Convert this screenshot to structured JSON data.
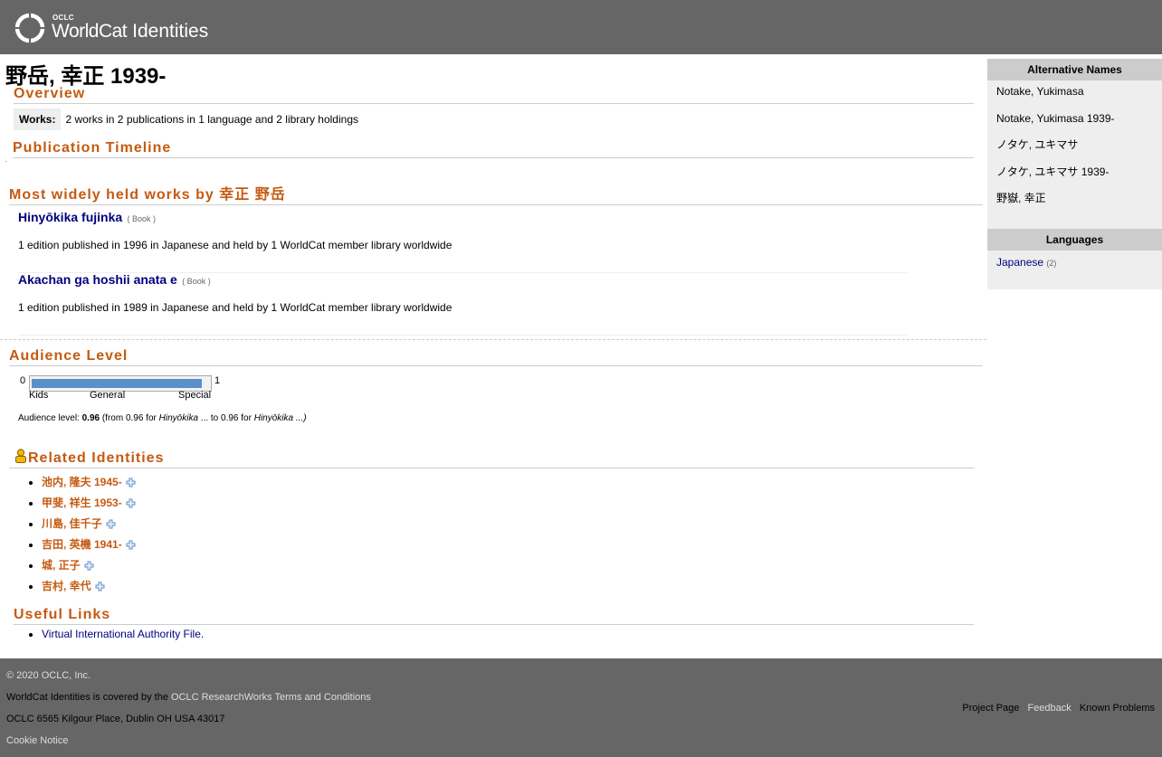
{
  "header": {
    "logo_oclc": "OCLC",
    "logo_worldcat": "WorldCat",
    "logo_identities": "Identities"
  },
  "page_title": "野岳, 幸正 1939-",
  "overview": {
    "heading": "Overview",
    "works_label": "Works:",
    "works_value": "2 works in 2 publications in 1 language and 2 library holdings"
  },
  "timeline": {
    "heading": "Publication Timeline"
  },
  "most_held": {
    "heading": "Most widely held works by 幸正 野岳",
    "works": [
      {
        "title": "Hinyōkika fujinka",
        "type": "( Book )",
        "desc": "1 edition published in 1996 in Japanese and held by 1 WorldCat member library worldwide"
      },
      {
        "title": "Akachan ga hoshii anata e",
        "type": "( Book )",
        "desc": "1 edition published in 1989 in Japanese and held by 1 WorldCat member library worldwide"
      }
    ]
  },
  "audience": {
    "heading": "Audience Level",
    "min_label": "0",
    "max_label": "1",
    "level": 0.96,
    "tick_kids": "Kids",
    "tick_general": "General",
    "tick_special": "Special",
    "text_prefix": "Audience level: ",
    "text_value": "0.96",
    "text_from": " (from 0.96 for ",
    "text_from_title": "Hinyōkika",
    "text_to": " ... to 0.96 for ",
    "text_to_title": "Hinyōkika",
    "text_end": " ...)"
  },
  "related": {
    "heading": "Related Identities",
    "items": [
      "池内, 隆夫 1945-",
      "甲斐, 祥生 1953-",
      "川島, 佳千子",
      "吉田, 英機 1941-",
      "城, 正子",
      "吉村, 幸代"
    ]
  },
  "useful_links": {
    "heading": "Useful Links",
    "items": [
      "Virtual International Authority File."
    ]
  },
  "sidebar": {
    "alt_names_heading": "Alternative Names",
    "alt_names": [
      "Notake, Yukimasa",
      "Notake, Yukimasa 1939-",
      "ノタケ, ユキマサ",
      "ノタケ, ユキマサ 1939-",
      "野嶽, 幸正"
    ],
    "languages_heading": "Languages",
    "language": "Japanese",
    "language_count": "(2)"
  },
  "footer": {
    "copyright": "© 2020 OCLC, Inc.",
    "covered_prefix": "WorldCat Identities is covered by the ",
    "covered_link": "OCLC ResearchWorks Terms and Conditions",
    "address": "OCLC 6565 Kilgour Place, Dublin OH USA 43017",
    "cookie": "Cookie Notice",
    "project_page": "Project Page",
    "feedback": "Feedback",
    "known_problems": "Known Problems"
  }
}
